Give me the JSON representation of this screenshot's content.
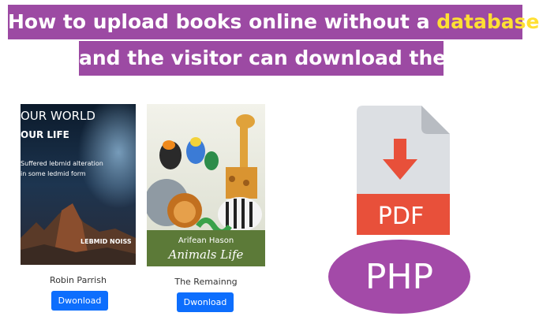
{
  "header": {
    "line1_prefix": "How to upload books online without a ",
    "line1_highlight": "database",
    "line1_suffix": ",",
    "line2": "and the visitor can download them"
  },
  "books": [
    {
      "cover_lines": [
        "OUR WORLD",
        "OUR LIFE",
        "Suffered lebmid alteration",
        "in some ledmid form",
        "LEBMID NOISS"
      ],
      "title": "Robin Parrish",
      "button_label": "Dwonload"
    },
    {
      "cover_lines": [
        "Arifean Hason",
        "Animals Life"
      ],
      "title": "The Remainng",
      "button_label": "Dwonload"
    }
  ],
  "pdf_icon": {
    "label": "PDF"
  },
  "php_badge": {
    "label": "PHP"
  },
  "colors": {
    "banner": "#9c4aa3",
    "highlight": "#ffe033",
    "button": "#0d6efd",
    "pdf_red": "#e8503a",
    "pdf_gray": "#dcdfe3",
    "php_purple": "#a34aa8"
  }
}
